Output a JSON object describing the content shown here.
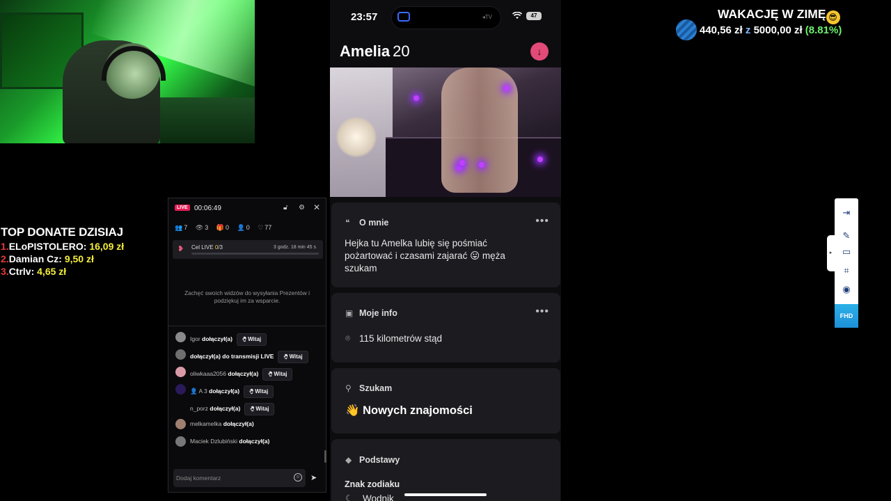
{
  "webcam": {
    "label": "webcam-feed"
  },
  "phone": {
    "status": {
      "time": "23:57",
      "battery": "47",
      "island_tag": "◂TV"
    },
    "profile": {
      "name": "Amelia",
      "age": "20"
    },
    "about": {
      "title": "O mnie",
      "text": "Hejka tu Amelka lubię się pośmiać pożartować i czasami zajarać 😛 męża szukam"
    },
    "info": {
      "title": "Moje info",
      "distance": "115 kilometrów stąd"
    },
    "seeking": {
      "title": "Szukam",
      "value": "Nowych znajomości",
      "emoji": "👋"
    },
    "basics": {
      "title": "Podstawy",
      "zodiac_label": "Znak zodiaku",
      "zodiac_value": "Wodnik"
    }
  },
  "live_panel": {
    "badge": "LIVE",
    "timer": "00:06:49",
    "stats": [
      {
        "icon": "users-icon",
        "symbol": "👥",
        "value": "7"
      },
      {
        "icon": "eye-icon",
        "symbol": "👁",
        "value": "3"
      },
      {
        "icon": "gift-icon",
        "symbol": "🎁",
        "value": "0"
      },
      {
        "icon": "follower-icon",
        "symbol": "👤",
        "value": "0"
      },
      {
        "icon": "heart-icon",
        "symbol": "♡",
        "value": "77"
      }
    ],
    "goal": {
      "label": "Cel LIVE",
      "progress": "0",
      "total": "/3",
      "time_left": "3 godz. 18 min 45 s",
      "fraction": 0
    },
    "encourage": "Zachęć swoich widzów do wysyłania Prezentów i podziękuj im za wsparcie.",
    "feed": [
      {
        "user": "Igor",
        "action": "dołączył(a)",
        "button": "Witaj",
        "avatar": "#8a8a8a"
      },
      {
        "user": "",
        "action": "dołączył(a) do transmisji LIVE",
        "button": "Witaj",
        "avatar": "#6f6f6f"
      },
      {
        "user": "oliwkaaa2056",
        "action": "dołączył(a)",
        "button": "Witaj",
        "avatar": "#d99aa8"
      },
      {
        "user": "👤 A 3",
        "action": "dołączył(a)",
        "button": "Witaj",
        "avatar": "#2a1a5a"
      },
      {
        "user": "n_porz",
        "action": "dołączył(a)",
        "button": "Witaj",
        "avatar": "#0a0a0c"
      },
      {
        "user": "melkamelka",
        "action": "dołączył(a)",
        "button": "",
        "avatar": "#a08070"
      },
      {
        "user": "Maciek Dzlubiński",
        "action": "dołączył(a)",
        "button": "",
        "avatar": "#777"
      }
    ],
    "comment_placeholder": "Dodaj komentarz"
  },
  "top_donate": {
    "title": "TOP DONATE DZISIAJ",
    "rows": [
      {
        "rank": "1.",
        "name": "ELoPISTOLERO:",
        "amount": "16,09 zł"
      },
      {
        "rank": "2.",
        "name": "Damian Cz:",
        "amount": "9,50 zł"
      },
      {
        "rank": "3.",
        "name": "Ctrlv:",
        "amount": "4,65 zł"
      }
    ]
  },
  "goal_widget": {
    "title": "WAKACJĘ W ZIMĘ",
    "emoji": "😎",
    "current": "440,56 zł",
    "z": "z",
    "target": "5000,00 zł",
    "percent": "(8.81%)",
    "fraction": 0.0881
  },
  "toolbar": {
    "items": [
      "exit-icon",
      "pen-icon",
      "crop-icon",
      "frame-icon",
      "record-icon"
    ],
    "fhd_label": "FHD"
  },
  "colors": {
    "live_red": "#e61d55",
    "accent_yellow": "#f5ee3a",
    "donate_red": "#e33b3b",
    "goal_green": "#6cf26c"
  }
}
